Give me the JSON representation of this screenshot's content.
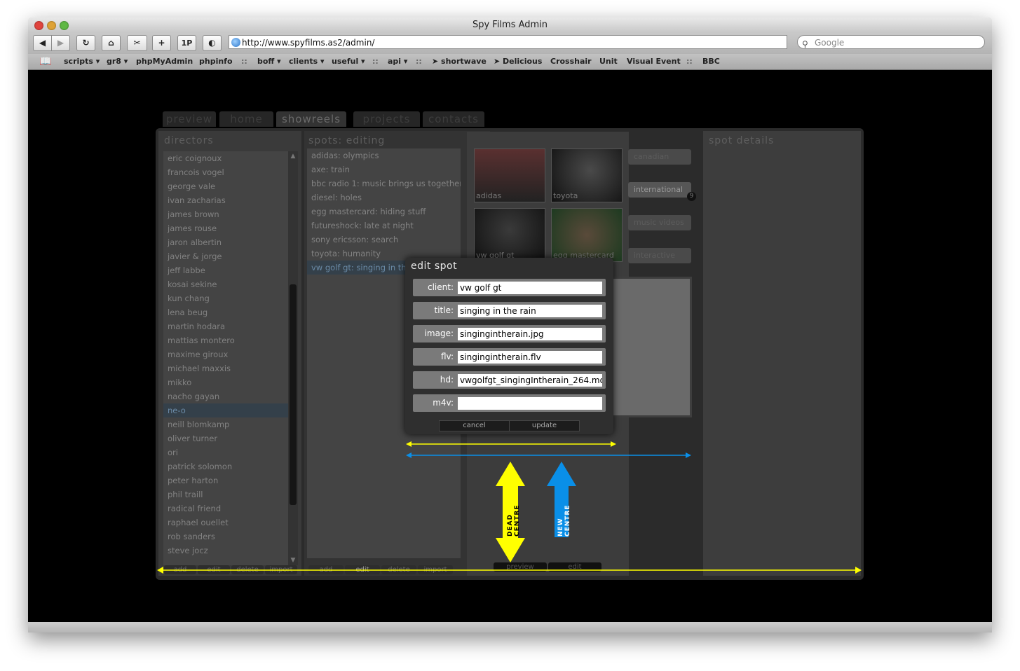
{
  "window": {
    "title": "Spy Films Admin"
  },
  "toolbar": {
    "back": "◀",
    "forward": "▶",
    "reload": "↻",
    "home": "⌂",
    "snapback": "✂",
    "add": "+",
    "onepassword": "1P",
    "unknown": "◐",
    "url": "http://www.spyfilms.as2/admin/",
    "search_placeholder": "Google"
  },
  "bookmarks": [
    "scripts ▾",
    "gr8 ▾",
    "phpMyAdmin",
    "phpinfo",
    "::",
    "boff ▾",
    "clients ▾",
    "useful ▾",
    "::",
    "api ▾",
    "::",
    "➤ shortwave",
    "➤ Delicious",
    "Crosshair",
    "Unit",
    "Visual Event",
    "::",
    "BBC"
  ],
  "nav_tabs": [
    "preview",
    "home",
    "showreels",
    "projects",
    "contacts"
  ],
  "directors": {
    "heading": "directors",
    "items": [
      "eric coignoux",
      "francois vogel",
      "george vale",
      "ivan zacharias",
      "james brown",
      "james rouse",
      "jaron albertin",
      "javier & jorge",
      "jeff labbe",
      "kosai sekine",
      "kun chang",
      "lena beug",
      "martin hodara",
      "mattias montero",
      "maxime giroux",
      "michael maxxis",
      "mikko",
      "nacho gayan",
      "ne-o",
      "neill blomkamp",
      "oliver turner",
      "ori",
      "patrick solomon",
      "peter harton",
      "phil traill",
      "radical friend",
      "raphael ouellet",
      "rob sanders",
      "steve jocz"
    ],
    "buttons": [
      "add",
      "edit",
      "delete",
      "import"
    ]
  },
  "spots": {
    "heading": "spots: editing",
    "items": [
      "adidas: olympics",
      "axe: train",
      "bbc radio 1: music brings us together",
      "diesel: holes",
      "egg mastercard: hiding stuff",
      "futureshock: late at night",
      "sony ericsson: search",
      "toyota: humanity",
      "vw golf gt: singing in the rain"
    ],
    "buttons": [
      "add",
      "edit",
      "delete",
      "import"
    ]
  },
  "showreel": {
    "thumbs": [
      "adidas",
      "toyota",
      "vw golf gt",
      "egg mastercard"
    ],
    "categories": [
      "canadian",
      "international",
      "music videos",
      "interactive"
    ],
    "badge": "9",
    "buttons": [
      "preview",
      "edit"
    ]
  },
  "spot_details": {
    "heading": "spot details"
  },
  "edit_spot": {
    "title": "edit spot",
    "fields": [
      {
        "label": "client:",
        "value": "vw golf gt"
      },
      {
        "label": "title:",
        "value": "singing in the rain"
      },
      {
        "label": "image:",
        "value": "singingintherain.jpg"
      },
      {
        "label": "flv:",
        "value": "singingintherain.flv"
      },
      {
        "label": "hd:",
        "value": "vwgolfgt_singingIntherain_264.mo"
      },
      {
        "label": "m4v:",
        "value": ""
      }
    ],
    "cancel": "cancel",
    "update": "update"
  },
  "annotations": {
    "dead_centre": "DEAD CENTRE",
    "new_centre": "NEW CENTRE"
  },
  "colors": {
    "yellow": "#ffff00",
    "blue": "#0a8fe8"
  }
}
